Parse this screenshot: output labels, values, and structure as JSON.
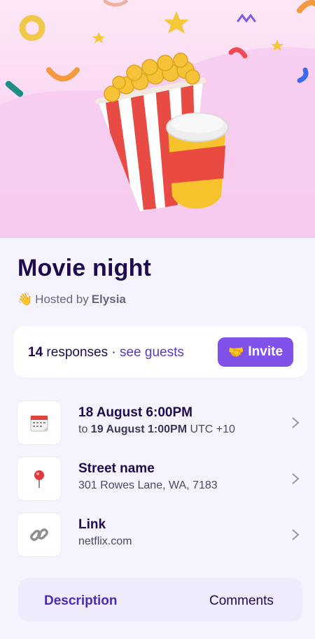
{
  "event": {
    "title": "Movie night",
    "host_prefix": "Hosted by",
    "host_name": "Elysia",
    "host_emoji": "👋"
  },
  "responses": {
    "count": "14",
    "label": "responses",
    "separator": "·",
    "guests_link": "see guests",
    "invite_label": "Invite",
    "invite_emoji": "🤝"
  },
  "details": [
    {
      "icon": "calendar-icon",
      "glyph": "📆",
      "primary": "18 August 6:00PM",
      "secondary_prefix": "to",
      "secondary_bold": "19 August 1:00PM",
      "secondary_suffix": "UTC +10"
    },
    {
      "icon": "pin-icon",
      "glyph": "📍",
      "primary": "Street name",
      "secondary": "301 Rowes Lane, WA, 7183"
    },
    {
      "icon": "link-icon",
      "glyph": "🔗",
      "primary": "Link",
      "secondary": "netflix.com"
    }
  ],
  "tabs": [
    {
      "label": "Description",
      "active": true
    },
    {
      "label": "Comments",
      "active": false
    }
  ],
  "colors": {
    "accent": "#8152ea",
    "title": "#1f0a4f",
    "link": "#5a38c7",
    "hero_bg": "#f9d6f1"
  }
}
